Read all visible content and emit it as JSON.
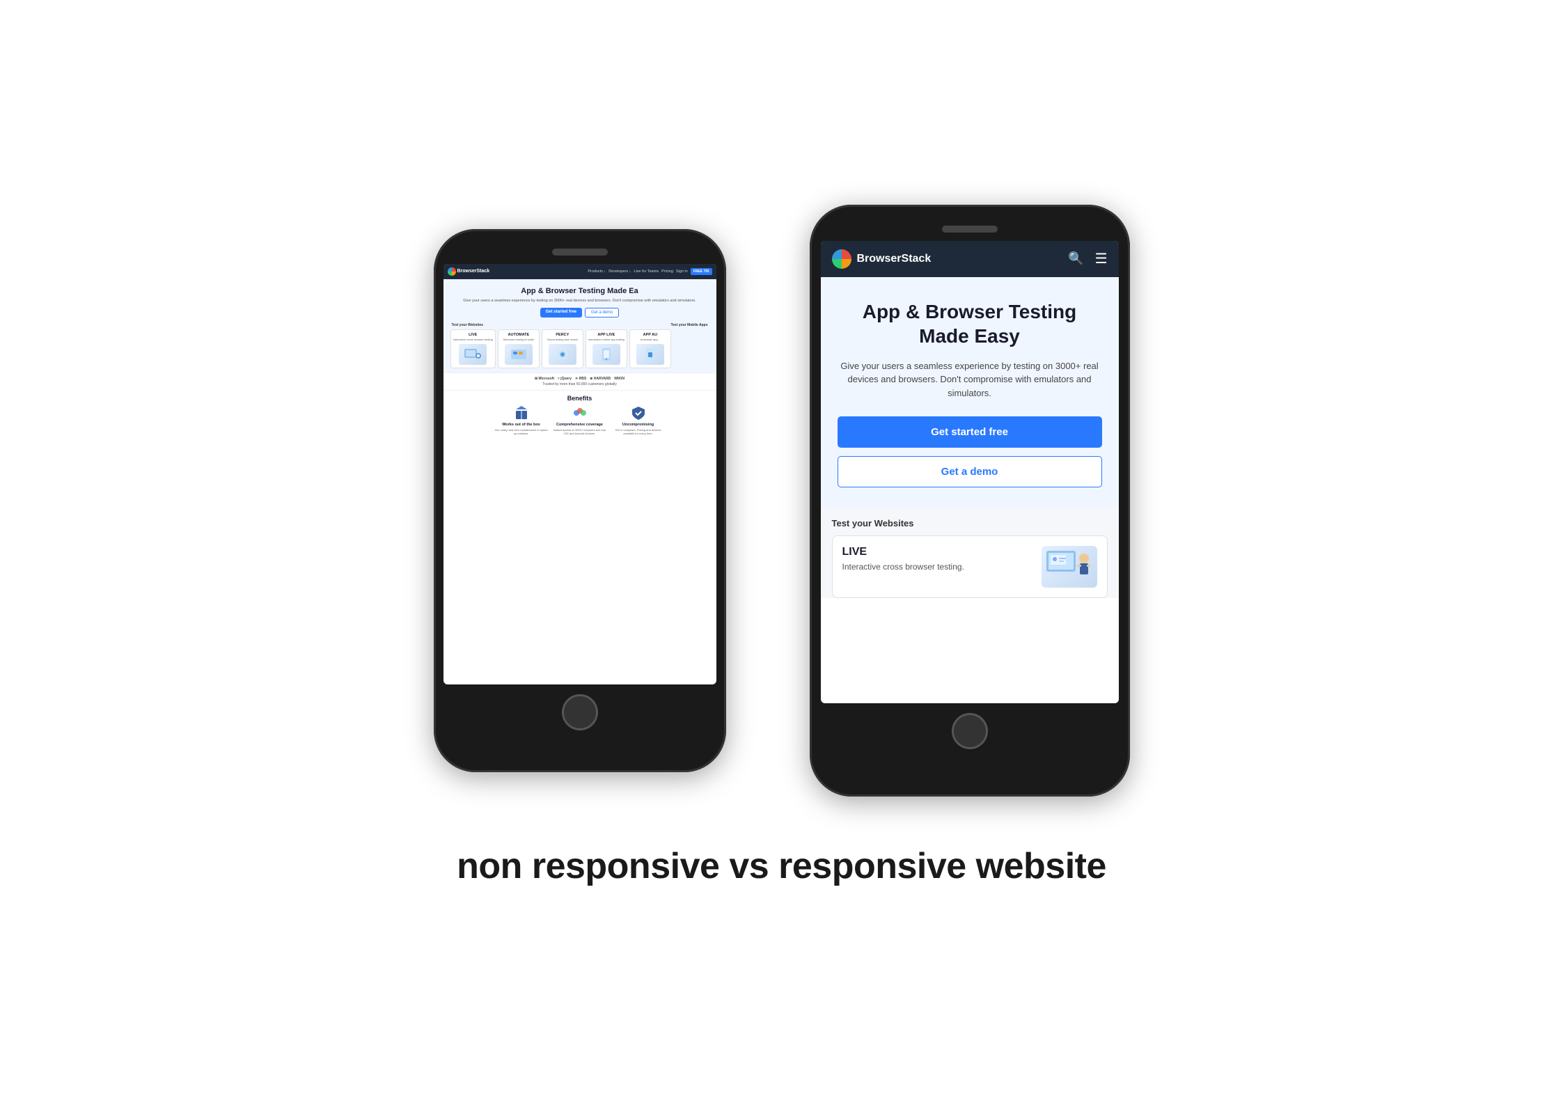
{
  "page": {
    "background": "#ffffff",
    "caption": "non responsive vs responsive website"
  },
  "left_phone": {
    "navbar": {
      "logo_text": "BrowserStack",
      "links": [
        "Products ↓",
        "Developers ↓",
        "Live for Teams",
        "Pricing",
        "Sign in"
      ],
      "cta": "FREE TRI"
    },
    "hero": {
      "title": "App & Browser Testing Made Ea",
      "subtitle": "Give your users a seamless experience by testing on 3000+ real devices and browsers. Don't compromise with emulators and simulators.",
      "btn_primary": "Get started free",
      "btn_outline": "Get a demo"
    },
    "test_websites_label": "Test your Websites",
    "test_mobile_label": "Test your Mobile Apps",
    "products": [
      {
        "name": "LIVE",
        "desc": "Interactive cross browser testing"
      },
      {
        "name": "AUTOMATE",
        "desc": "Selenium testing at scale"
      },
      {
        "name": "PERCY",
        "desc": "Visual testing and review"
      },
      {
        "name": "APP LIVE",
        "desc": "Interactive mobile app testing"
      },
      {
        "name": "APP AU",
        "desc": "Automate app..."
      }
    ],
    "trusted_logos": [
      "Microsoft",
      "jQuery",
      "RBS",
      "HARVARD",
      "WIKIN"
    ],
    "trusted_text": "Trusted by more than 50,000 customers globally",
    "benefits": {
      "title": "Benefits",
      "items": [
        {
          "name": "Works out of the box",
          "desc": "Zero setup and zero maintenance to speed up releases."
        },
        {
          "name": "Comprehensive coverage",
          "desc": "Instant access to 3000+ browsers and real iOS and Android devices."
        },
        {
          "name": "Uncompromising",
          "desc": "SOC2 compliant. Pricing and devices available for every time."
        }
      ]
    }
  },
  "right_phone": {
    "navbar": {
      "logo_text": "BrowserStack"
    },
    "hero": {
      "title": "App & Browser Testing Made Easy",
      "subtitle": "Give your users a seamless experience by testing on 3000+ real devices and browsers. Don't compromise with emulators and simulators.",
      "btn_primary": "Get started free",
      "btn_outline": "Get a demo"
    },
    "test_websites_label": "Test your Websites",
    "live_product": {
      "name": "LIVE",
      "desc": "Interactive cross browser testing."
    }
  }
}
